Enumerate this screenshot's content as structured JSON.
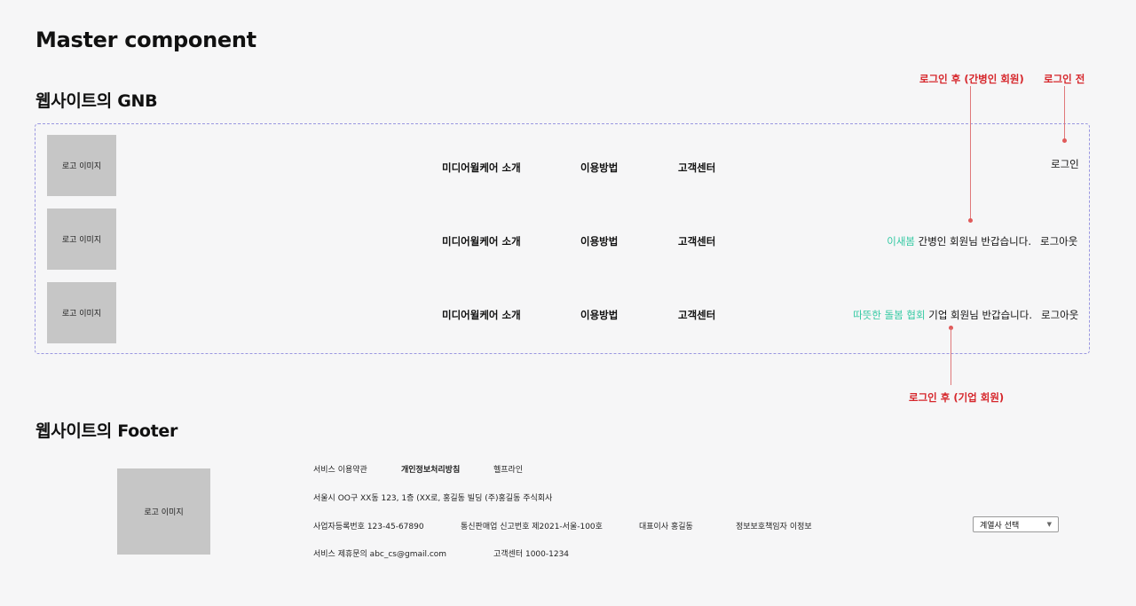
{
  "page_title": "Master component",
  "gnb": {
    "heading": "웹사이트의 GNB",
    "logo_text": "로고 이미지",
    "nav": [
      "미디어윌케어 소개",
      "이용방법",
      "고객센터"
    ],
    "row1": {
      "login": "로그인"
    },
    "row2": {
      "name": "이새봄",
      "greeting": " 간병인 회원님 반갑습니다.",
      "logout": "로그아웃"
    },
    "row3": {
      "name": "따뜻한 돌봄 협회",
      "greeting": " 기업 회원님 반갑습니다.",
      "logout": "로그아웃"
    }
  },
  "annotations": {
    "after_login_caregiver": "로그인 후 (간병인 회원)",
    "before_login": "로그인 전",
    "after_login_company": "로그인 후 (기업 회원)"
  },
  "footer": {
    "heading": "웹사이트의 Footer",
    "logo_text": "로고 이미지",
    "links": [
      "서비스 이용약관",
      "개인정보처리방침",
      "헬프라인"
    ],
    "address": "서울시 OO구 XX동 123, 1층 (XX로, 홍길동 빌딩 (주)홍길동 주식회사",
    "info": [
      "사업자등록번호 123-45-67890",
      "통신판매업 신고번호 제2021-서울-100호",
      "대표이사 홍길동",
      "정보보호책임자 이정보"
    ],
    "contact": [
      "서비스 제휴문의 abc_cs@gmail.com",
      "고객센터 1000-1234"
    ],
    "affiliate_select": "계열사 선택"
  },
  "colors": {
    "accent": "#34c9a3",
    "annotation": "#d6262b",
    "dashed_border": "#9a97e0",
    "logo_placeholder": "#c6c6c6"
  }
}
